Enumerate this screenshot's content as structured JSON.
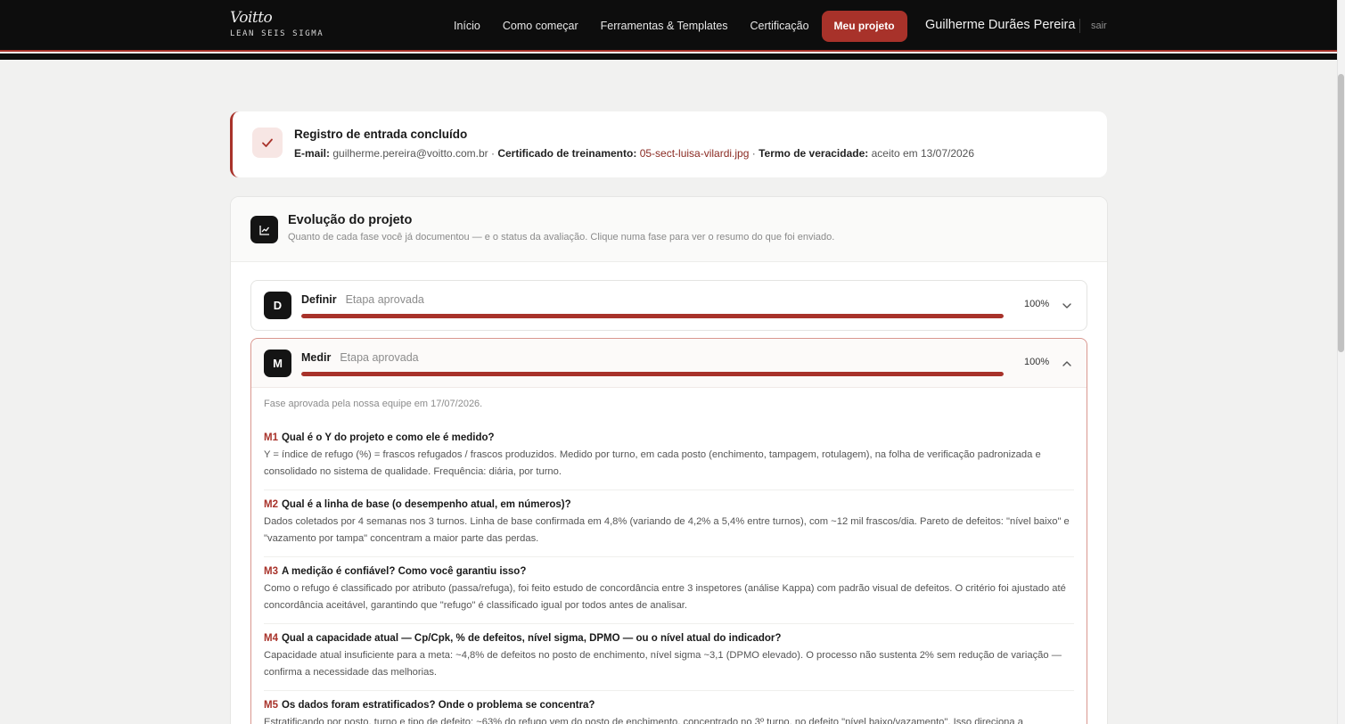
{
  "brand": {
    "name": "Voitto",
    "tagline": "LEAN SEIS SIGMA"
  },
  "nav": {
    "items": [
      "Início",
      "Como começar",
      "Ferramentas & Templates",
      "Certificação"
    ],
    "cta": "Meu projeto",
    "user": "Guilherme Durães Pereira",
    "logout": "sair"
  },
  "notice": {
    "title": "Registro de entrada concluído",
    "email_label": "E-mail:",
    "email": "guilherme.pereira@voitto.com.br",
    "cert_label": "Certificado de treinamento:",
    "cert_file": "05-sect-luisa-vilardi.jpg",
    "terms_label": "Termo de veracidade:",
    "terms_value": "aceito em 13/07/2026",
    "dot": "·"
  },
  "evolution": {
    "title": "Evolução do projeto",
    "subtitle": "Quanto de cada fase você já documentou — e o status da avaliação. Clique numa fase para ver o resumo do que foi enviado.",
    "phases": [
      {
        "letter": "D",
        "name": "Definir",
        "status": "Etapa aprovada",
        "progress": 100,
        "pct_label": "100%"
      },
      {
        "letter": "M",
        "name": "Medir",
        "status": "Etapa aprovada",
        "progress": 100,
        "pct_label": "100%",
        "approved_note": "Fase aprovada pela nossa equipe em 17/07/2026.",
        "questions": [
          {
            "code": "M1",
            "q": "Qual é o Y do projeto e como ele é medido?",
            "a": "Y = índice de refugo (%) = frascos refugados / frascos produzidos. Medido por turno, em cada posto (enchimento, tampagem, rotulagem), na folha de verificação padronizada e consolidado no sistema de qualidade. Frequência: diária, por turno."
          },
          {
            "code": "M2",
            "q": "Qual é a linha de base (o desempenho atual, em números)?",
            "a": "Dados coletados por 4 semanas nos 3 turnos. Linha de base confirmada em 4,8% (variando de 4,2% a 5,4% entre turnos), com ~12 mil frascos/dia. Pareto de defeitos: \"nível baixo\" e \"vazamento por tampa\" concentram a maior parte das perdas."
          },
          {
            "code": "M3",
            "q": "A medição é confiável? Como você garantiu isso?",
            "a": "Como o refugo é classificado por atributo (passa/refuga), foi feito estudo de concordância entre 3 inspetores (análise Kappa) com padrão visual de defeitos. O critério foi ajustado até concordância aceitável, garantindo que \"refugo\" é classificado igual por todos antes de analisar."
          },
          {
            "code": "M4",
            "q": "Qual a capacidade atual — Cp/Cpk, % de defeitos, nível sigma, DPMO — ou o nível atual do indicador?",
            "a": "Capacidade atual insuficiente para a meta: ~4,8% de defeitos no posto de enchimento, nível sigma ~3,1 (DPMO elevado). O processo não sustenta 2% sem redução de variação — confirma a necessidade das melhorias."
          },
          {
            "code": "M5",
            "q": "Os dados foram estratificados? Onde o problema se concentra?",
            "a": "Estratificando por posto, turno e tipo de defeito: ~63% do refugo vem do posto de enchimento, concentrado no 3º turno, no defeito \"nível baixo/vazamento\". Isso direciona a"
          }
        ]
      }
    ]
  }
}
